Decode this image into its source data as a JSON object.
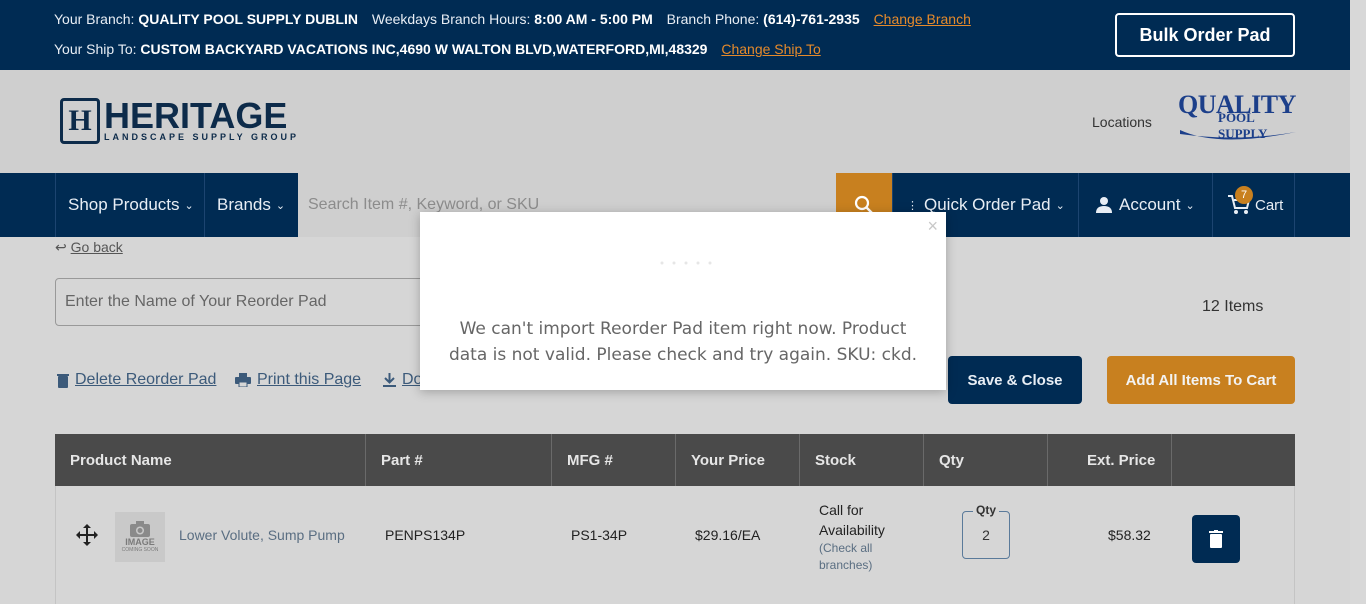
{
  "topbar": {
    "branch_label": "Your Branch:",
    "branch_name": "QUALITY POOL SUPPLY DUBLIN",
    "hours_label": "Weekdays Branch Hours:",
    "hours": "8:00 AM - 5:00 PM",
    "phone_label": "Branch Phone:",
    "phone": "(614)-761-2935",
    "change_branch": "Change Branch",
    "shipto_label": "Your Ship To:",
    "shipto": "CUSTOM BACKYARD VACATIONS INC,4690 W WALTON BLVD,WATERFORD,MI,48329",
    "change_shipto": "Change Ship To",
    "bulk_order": "Bulk Order Pad"
  },
  "header": {
    "logo_main": "HERITAGE",
    "logo_sub": "LANDSCAPE SUPPLY GROUP",
    "logo_mark": "H",
    "locations": "Locations",
    "partner_logo_main": "QUALITY",
    "partner_logo_sub": "POOL SUPPLY"
  },
  "nav": {
    "shop_products": "Shop Products",
    "brands": "Brands",
    "search_placeholder": "Search Item #, Keyword, or SKU",
    "quick_order": "Quick Order Pad",
    "account": "Account",
    "cart": "Cart",
    "cart_count": "7"
  },
  "page": {
    "go_back": "Go back",
    "pad_name_placeholder": "Enter the Name of Your Reorder Pad",
    "items_count": "12 Items",
    "delete_pad": "Delete Reorder Pad",
    "print_page": "Print this Page",
    "download": "Do",
    "save_close": "Save & Close",
    "add_all": "Add All Items To Cart"
  },
  "table": {
    "headers": [
      "Product Name",
      "Part #",
      "MFG #",
      "Your Price",
      "Stock",
      "Qty",
      "Ext. Price"
    ],
    "rows": [
      {
        "thumb_text": "IMAGE",
        "thumb_sub": "COMING SOON",
        "product_name": "Lower Volute, Sump Pump",
        "part": "PENPS134P",
        "mfg": "PS1-34P",
        "price": "$29.16/EA",
        "stock_line1": "Call for",
        "stock_line2": "Availability",
        "stock_note1": "(Check all",
        "stock_note2": "branches)",
        "qty_label": "Qty",
        "qty": "2",
        "ext_price": "$58.32"
      }
    ]
  },
  "modal": {
    "close": "×",
    "message_line1": "We can't import Reorder Pad item right now. Product",
    "message_line2": "data is not valid. Please check and try again. SKU: ckd."
  },
  "colors": {
    "navy": "#002b53",
    "orange": "#c8801f",
    "link_orange": "#e58a2b"
  }
}
